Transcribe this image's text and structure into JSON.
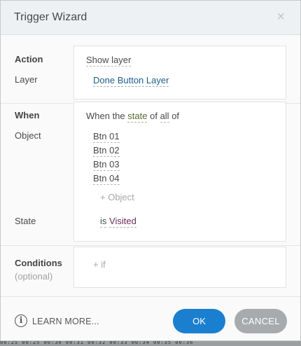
{
  "dialog": {
    "title": "Trigger Wizard",
    "close_glyph": "×"
  },
  "action": {
    "label": "Action",
    "value": "Show layer",
    "layer_label": "Layer",
    "layer_value": "Done Button Layer"
  },
  "when": {
    "label": "When",
    "object_label": "Object",
    "state_label": "State",
    "sentence_prefix": "When the",
    "sentence_state": "state",
    "sentence_of": "of",
    "sentence_all": "all",
    "sentence_of2": "of",
    "objects": [
      "Btn 01",
      "Btn 02",
      "Btn 03",
      "Btn 04"
    ],
    "add_object": "+ Object",
    "state_is": "is",
    "state_value": "Visited"
  },
  "conditions": {
    "label": "Conditions",
    "sublabel": "(optional)",
    "add_if": "+ if"
  },
  "footer": {
    "info_icon": "info-icon",
    "info_glyph": "i",
    "learn_more": "LEARN MORE...",
    "ok": "OK",
    "cancel": "CANCEL"
  },
  "colors": {
    "ok_button": "#1b7fcf",
    "cancel_button": "#a8abad",
    "link": "#1d5d8a",
    "state_word": "#556b2f",
    "state_value": "#6b2c5c"
  },
  "background": {
    "ticks": "00:25   00:25   00:30   00:31   00:32   00:33   00:34   00:35   00:36"
  }
}
